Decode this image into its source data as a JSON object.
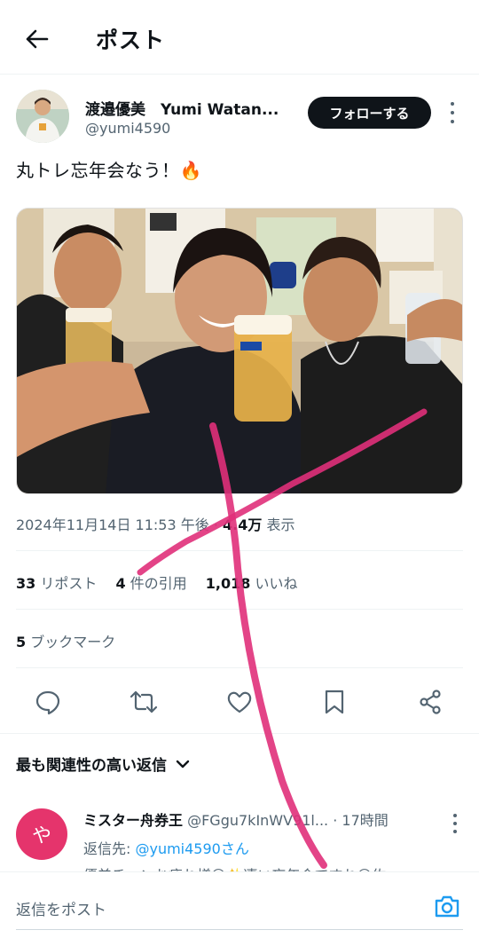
{
  "header": {
    "title": "ポスト"
  },
  "author": {
    "name": "渡邉優美　Yumi Watan...",
    "handle": "@yumi4590",
    "follow_label": "フォローする"
  },
  "post": {
    "text": "丸トレ忘年会なう！🔥"
  },
  "meta": {
    "datetime": "2024年11月14日 11:53 午後",
    "sep": " · ",
    "views": "4.4万",
    "views_label": " 表示"
  },
  "stats": {
    "reposts": "33",
    "reposts_label": " リポスト",
    "quotes": "4",
    "quotes_label": " 件の引用",
    "likes": "1,018",
    "likes_label": " いいね"
  },
  "bookmarks": {
    "count": "5",
    "label": " ブックマーク"
  },
  "actions": [
    "reply-icon",
    "repost-icon",
    "like-icon",
    "bookmark-icon",
    "share-icon"
  ],
  "relevance": {
    "label": "最も関連性の高い返信"
  },
  "reply": {
    "avatar_char": "や",
    "name": "ミスター舟券王",
    "handle": " @FGgu7kInWV91l...",
    "time": " · 17時間",
    "to_label": "返信先: ",
    "to_handle": "@yumi4590さん",
    "body": "優美チャンお疲れ様😊✨凄い忘年会ですね😊佐"
  },
  "composer": {
    "placeholder": "返信をポスト"
  },
  "colors": {
    "text": "#0f1419",
    "secondary": "#536471",
    "accent": "#1d9bf0",
    "scribble": "#e0307a",
    "reply_avatar": "#e5346c"
  }
}
